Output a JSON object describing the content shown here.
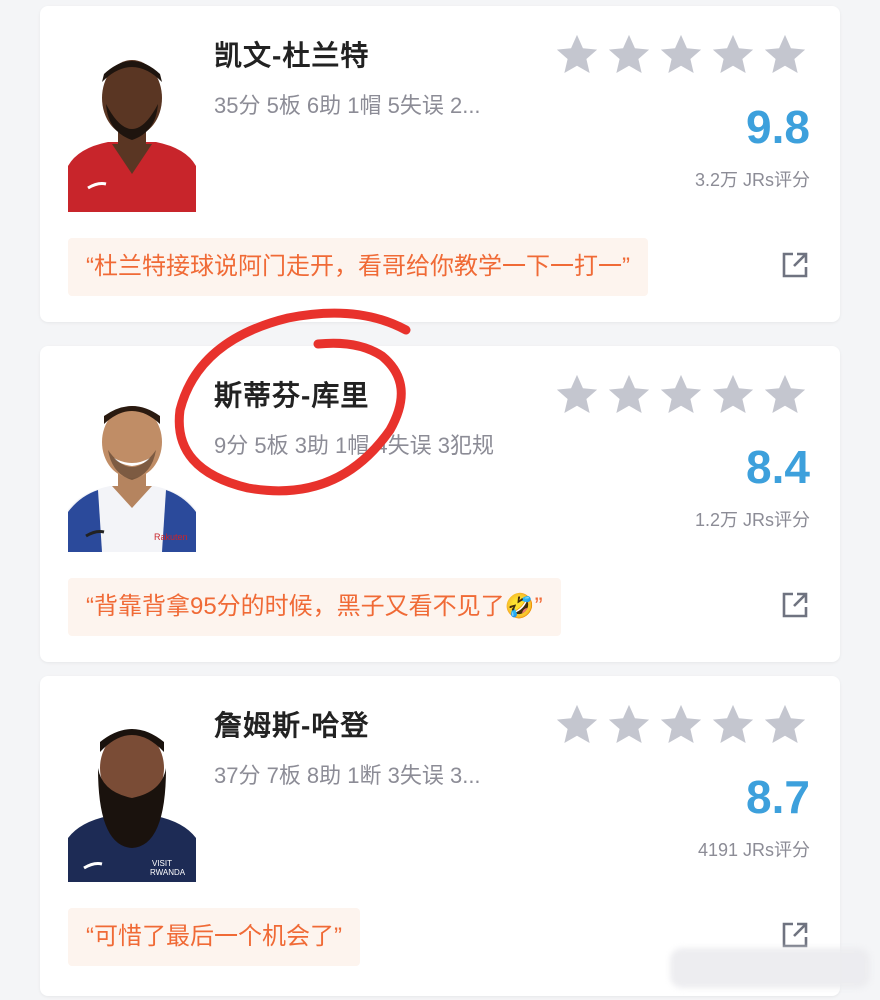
{
  "cards": [
    {
      "name": "凯文-杜兰特",
      "stats": "35分 5板 6助 1帽 5失误 2...",
      "score": "9.8",
      "rating_count": "3.2万 JRs评分",
      "comment": "“杜兰特接球说阿门走开，看哥给你教学一下一打一”",
      "stars": 5,
      "avatar_icon": "player-portrait-icon",
      "jersey_color": "#c8252b"
    },
    {
      "name": "斯蒂芬-库里",
      "stats": "9分 5板 3助 1帽 4失误 3犯规",
      "score": "8.4",
      "rating_count": "1.2万 JRs评分",
      "comment": "“背靠背拿95分的时候，黑子又看不见了🤣”",
      "stars": 5,
      "avatar_icon": "player-portrait-icon",
      "jersey_color": "#ffffff"
    },
    {
      "name": "詹姆斯-哈登",
      "stats": "37分 7板 8助 1断 3失误 3...",
      "score": "8.7",
      "rating_count": "4191 JRs评分",
      "comment": "“可惜了最后一个机会了”",
      "stars": 5,
      "avatar_icon": "player-portrait-icon",
      "jersey_color": "#1d2b55"
    }
  ],
  "colors": {
    "score": "#3da0dc",
    "comment_text": "#f06a36",
    "comment_bg": "#fdf4ee",
    "star": "#c4c6cf",
    "annotation": "#e8322c"
  }
}
